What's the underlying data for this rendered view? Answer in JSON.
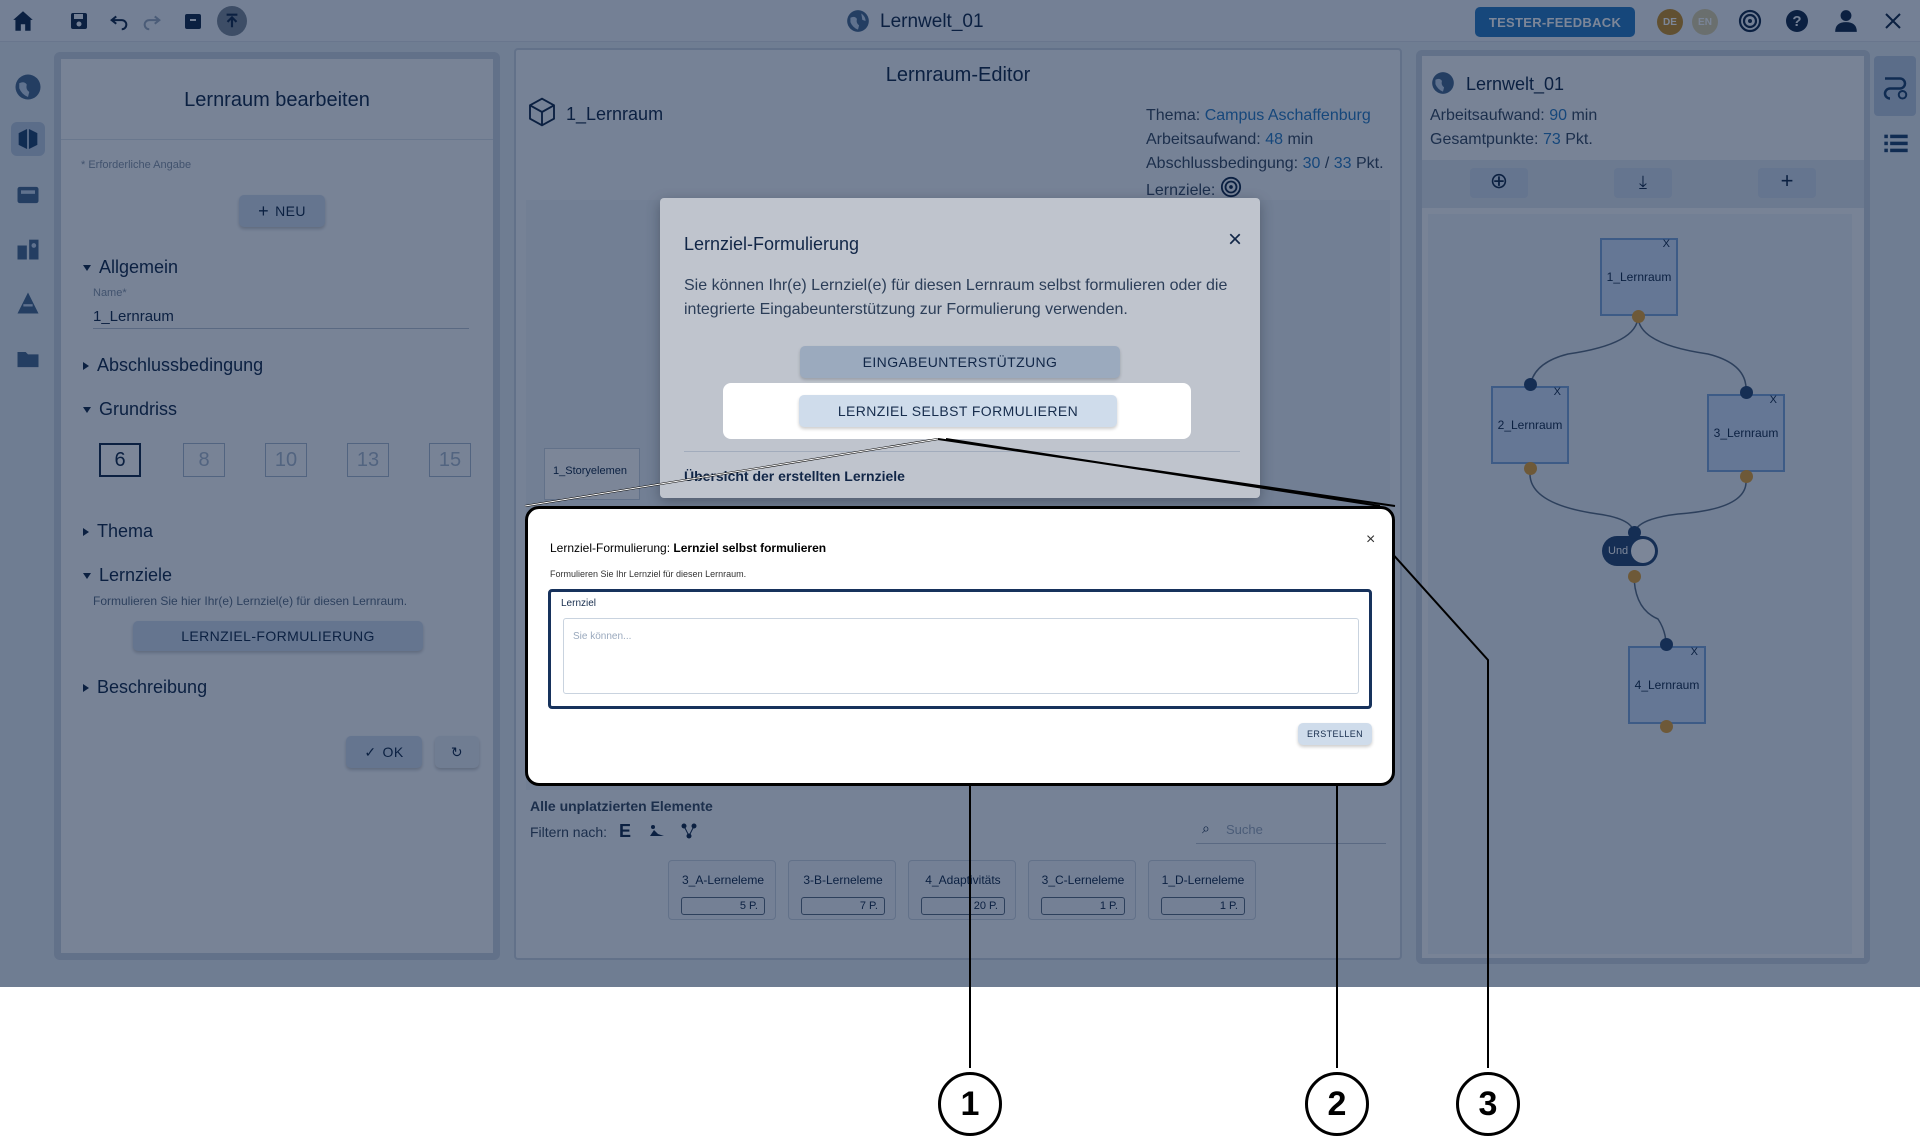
{
  "topbar": {
    "title": "Lernwelt_01",
    "tester_feedback": "TESTER-FEEDBACK",
    "lang_de": "DE",
    "lang_en": "EN"
  },
  "left_panel": {
    "title": "Lernraum bearbeiten",
    "required_hint": "* Erforderliche Angabe",
    "new_button": "NEU",
    "section_general": "Allgemein",
    "name_label": "Name*",
    "name_value": "1_Lernraum",
    "section_completion": "Abschlussbedingung",
    "section_floorplan": "Grundriss",
    "floorplan_options": [
      "6",
      "8",
      "10",
      "13",
      "15"
    ],
    "section_theme": "Thema",
    "section_goals": "Lernziele",
    "goals_hint": "Formulieren Sie hier Ihr(e) Lernziel(e) für diesen Lernraum.",
    "goals_button": "LERNZIEL-FORMULIERUNG",
    "section_description": "Beschreibung",
    "ok_button": "OK"
  },
  "editor": {
    "title": "Lernraum-Editor",
    "room_name": "1_Lernraum",
    "theme_label": "Thema:",
    "theme_value": "Campus Aschaffenburg",
    "workload_label": "Arbeitsaufwand:",
    "workload_value": "48",
    "workload_unit": "min",
    "completion_label": "Abschlussbedingung:",
    "completion_value": "30",
    "completion_sep": "/",
    "completion_total": "33",
    "completion_unit": "Pkt.",
    "goals_label": "Lernziele:",
    "story_element": "1_Storyelemen",
    "unplaced_title": "Alle unplatzierten Elemente",
    "filter_label": "Filtern nach:",
    "search_placeholder": "Suche",
    "elements": [
      {
        "name": "3_A-Lerneleme",
        "points": "5 P."
      },
      {
        "name": "3-B-Lerneleme",
        "points": "7 P."
      },
      {
        "name": "4_Adaptivitäts",
        "points": "20 P."
      },
      {
        "name": "3_C-Lerneleme",
        "points": "1 P."
      },
      {
        "name": "1_D-Lerneleme",
        "points": "1 P."
      }
    ]
  },
  "right_panel": {
    "world_name": "Lernwelt_01",
    "workload_label": "Arbeitsaufwand:",
    "workload_value": "90",
    "workload_unit": "min",
    "points_label": "Gesamtpunkte:",
    "points_value": "73",
    "points_unit": "Pkt.",
    "nodes": {
      "room1": "1_Lernraum",
      "room2": "2_Lernraum",
      "room3": "3_Lernraum",
      "room4": "4_Lernraum",
      "and_toggle": "Und"
    },
    "close_mark": "X"
  },
  "dialog": {
    "title": "Lernziel-Formulierung",
    "text": "Sie können Ihr(e) Lernziel(e) für diesen Lernraum selbst formulieren oder die integrierte Eingabeunterstützung zur Formulierung verwenden.",
    "assist_button": "EINGABEUNTERSTÜTZUNG",
    "self_button": "LERNZIEL SELBST FORMULIEREN",
    "overview": "Übersicht der erstellten Lernziele"
  },
  "zoom": {
    "title_prefix": "Lernziel-Formulierung:",
    "title_bold": "Lernziel selbst formulieren",
    "subtitle": "Formulieren Sie Ihr Lernziel für diesen Lernraum.",
    "field_label": "Lernziel",
    "field_placeholder": "Sie können...",
    "create_button": "ERSTELLEN"
  },
  "callouts": [
    "1",
    "2",
    "3"
  ],
  "colors": {
    "brand": "#2f7fc4",
    "orange": "#e2a23b",
    "navy": "#172d4d"
  }
}
